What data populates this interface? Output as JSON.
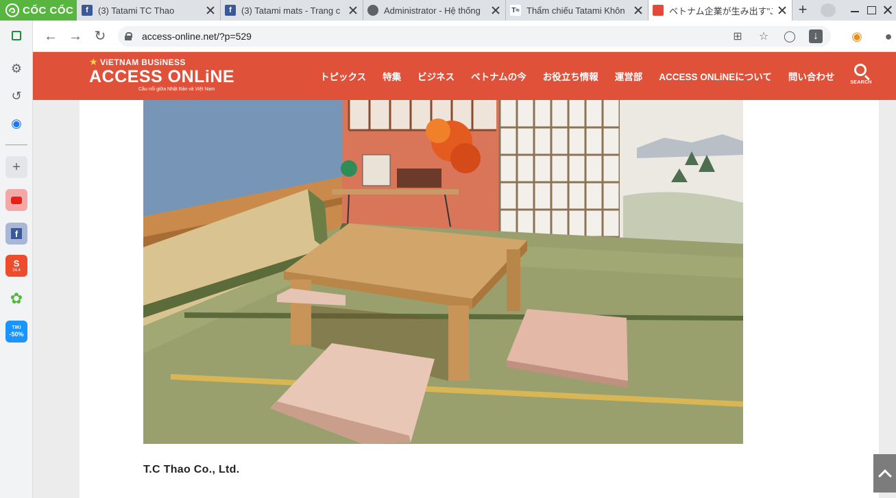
{
  "browser": {
    "brand": "CỐC CỐC",
    "tabs": [
      {
        "label": "(3) Tatami TC Thao",
        "favicon": "facebook-icon"
      },
      {
        "label": "(3) Tatami mats - Trang c",
        "favicon": "facebook-icon"
      },
      {
        "label": "Administrator - Hệ thống",
        "favicon": "globe-icon"
      },
      {
        "label": "Thẩm chiếu Tatami Khôn",
        "favicon": "ta-site-icon"
      },
      {
        "label": "ベトナム企業が生み出す\"JA",
        "favicon": "access-online-icon",
        "active": true
      }
    ],
    "new_tab": "+",
    "url": "access-online.net/?p=529"
  },
  "sidebar": {
    "items": [
      {
        "name": "reading-mode-icon"
      },
      {
        "name": "settings-icon"
      },
      {
        "name": "history-icon"
      },
      {
        "name": "messenger-icon"
      },
      {
        "name": "add-shortcut-icon"
      },
      {
        "name": "youtube-icon"
      },
      {
        "name": "facebook-icon"
      },
      {
        "name": "shopee-icon",
        "badge": "24.4"
      },
      {
        "name": "coccoc-app-icon"
      },
      {
        "name": "tiki-icon",
        "badge_top": "TIKI",
        "badge": "-50%"
      }
    ]
  },
  "site": {
    "logo_top": "ViETNAM BUSiNESS",
    "logo_main": "ACCESS ONLiNE",
    "logo_sub": "Cầu nối giữa Nhật Bản và Việt Nam",
    "nav": [
      "トピックス",
      "特集",
      "ビジネス",
      "ベトナムの今",
      "お役立ち情報",
      "運営部",
      "ACCESS ONLiNEについて",
      "問い合わせ"
    ],
    "search_label": "SEARCH"
  },
  "article": {
    "image_alt": "tatami-room-photo",
    "caption": "T.C Thao Co., Ltd."
  },
  "colors": {
    "header_red": "#e0513a",
    "coccoc_green": "#57b540"
  }
}
